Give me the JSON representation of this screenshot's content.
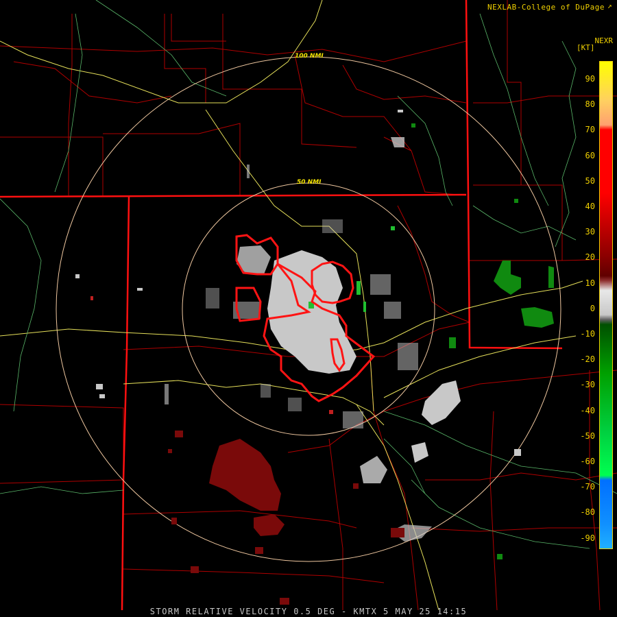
{
  "credit": "NEXLAB-College of DuPage",
  "credit_icon": "external-link-icon",
  "product_code": "NEXR",
  "unit_label": "[KT]",
  "footer": "STORM RELATIVE VELOCITY 0.5 DEG - KMTX 5 MAY 25 14:15",
  "range_rings": [
    "50 NMI",
    "100 NMI"
  ],
  "legend": {
    "ticks": [
      "90",
      "80",
      "70",
      "60",
      "50",
      "40",
      "30",
      "20",
      "10",
      "0",
      "-10",
      "-20",
      "-30",
      "-40",
      "-50",
      "-60",
      "-70",
      "-80",
      "-90"
    ],
    "colors": {
      "top": "#ffff00",
      "high": "#ff0000",
      "low_red": "#8b0000",
      "zero": "#c8c8c8",
      "neg_green": "#00a000",
      "bright_green": "#00ff50",
      "blue": "#0070ff",
      "bottom": "#20b0ff"
    }
  }
}
